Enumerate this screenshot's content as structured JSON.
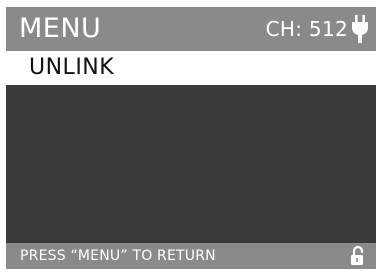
{
  "header": {
    "title": "MENU",
    "channel": "CH: 512",
    "power_icon": "plug-icon"
  },
  "menu": {
    "items": [
      {
        "label": "UNLINK",
        "selected": true
      }
    ]
  },
  "footer": {
    "hint": "PRESS “MENU” TO RETURN",
    "lock_icon": "unlocked-padlock-icon"
  },
  "colors": {
    "bar": "#8a8a8a",
    "screen": "#3a3a3a",
    "highlight": "#ffffff",
    "highlight_text": "#111111",
    "bar_text": "#ffffff"
  }
}
